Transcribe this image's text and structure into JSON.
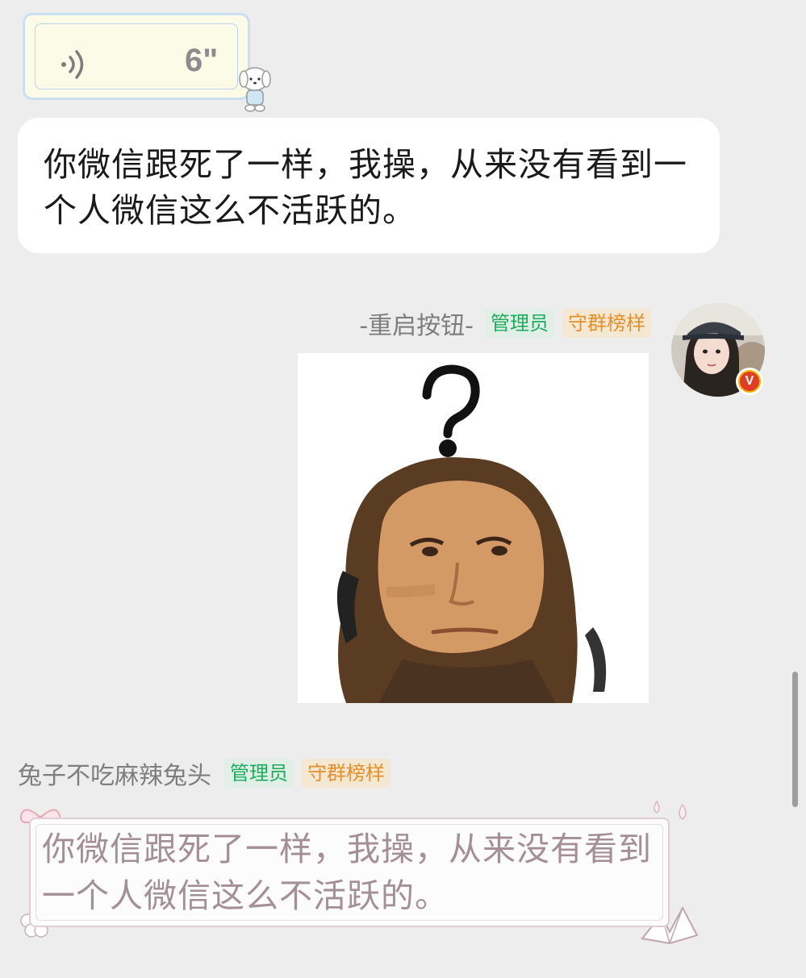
{
  "voice_message": {
    "duration": "6\""
  },
  "messages": [
    {
      "text": "你微信跟死了一样，我操，从来没有看到一个人微信这么不活跃的。"
    }
  ],
  "sender_1": {
    "name": "-重启按钮-",
    "tags": [
      "管理员",
      "守群榜样"
    ],
    "badge": "V"
  },
  "sticker_1": {
    "icon": "question-mark-face-meme"
  },
  "sender_2": {
    "name": "兔子不吃麻辣兔头",
    "tags": [
      "管理员",
      "守群榜样"
    ],
    "message": "你微信跟死了一样，我操，从来没有看到一个人微信这么不活跃的。"
  },
  "colors": {
    "background": "#ededed",
    "admin_tag": "#1aad5c",
    "model_tag": "#e3902a",
    "decorated_text": "#a58f96"
  }
}
